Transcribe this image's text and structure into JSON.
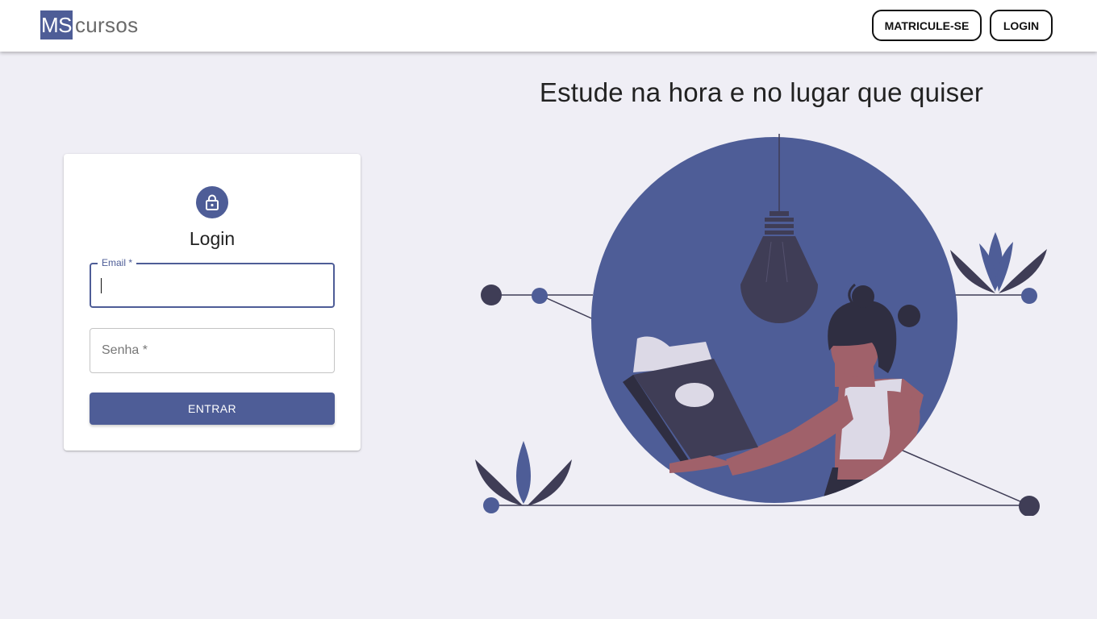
{
  "header": {
    "logo_ms": "MS",
    "logo_text": "cursos",
    "enroll_label": "MATRICULE-SE",
    "login_label": "LOGIN"
  },
  "login_card": {
    "title": "Login",
    "email_label": "Email *",
    "password_label": "Senha *",
    "submit_label": "ENTRAR"
  },
  "hero": {
    "headline": "Estude na hora e no lugar que quiser"
  },
  "colors": {
    "primary": "#4e5d97",
    "background": "#efeef5",
    "dark": "#3f3d56",
    "skin": "#a0616a"
  },
  "icons": {
    "lock": "lock-icon"
  }
}
